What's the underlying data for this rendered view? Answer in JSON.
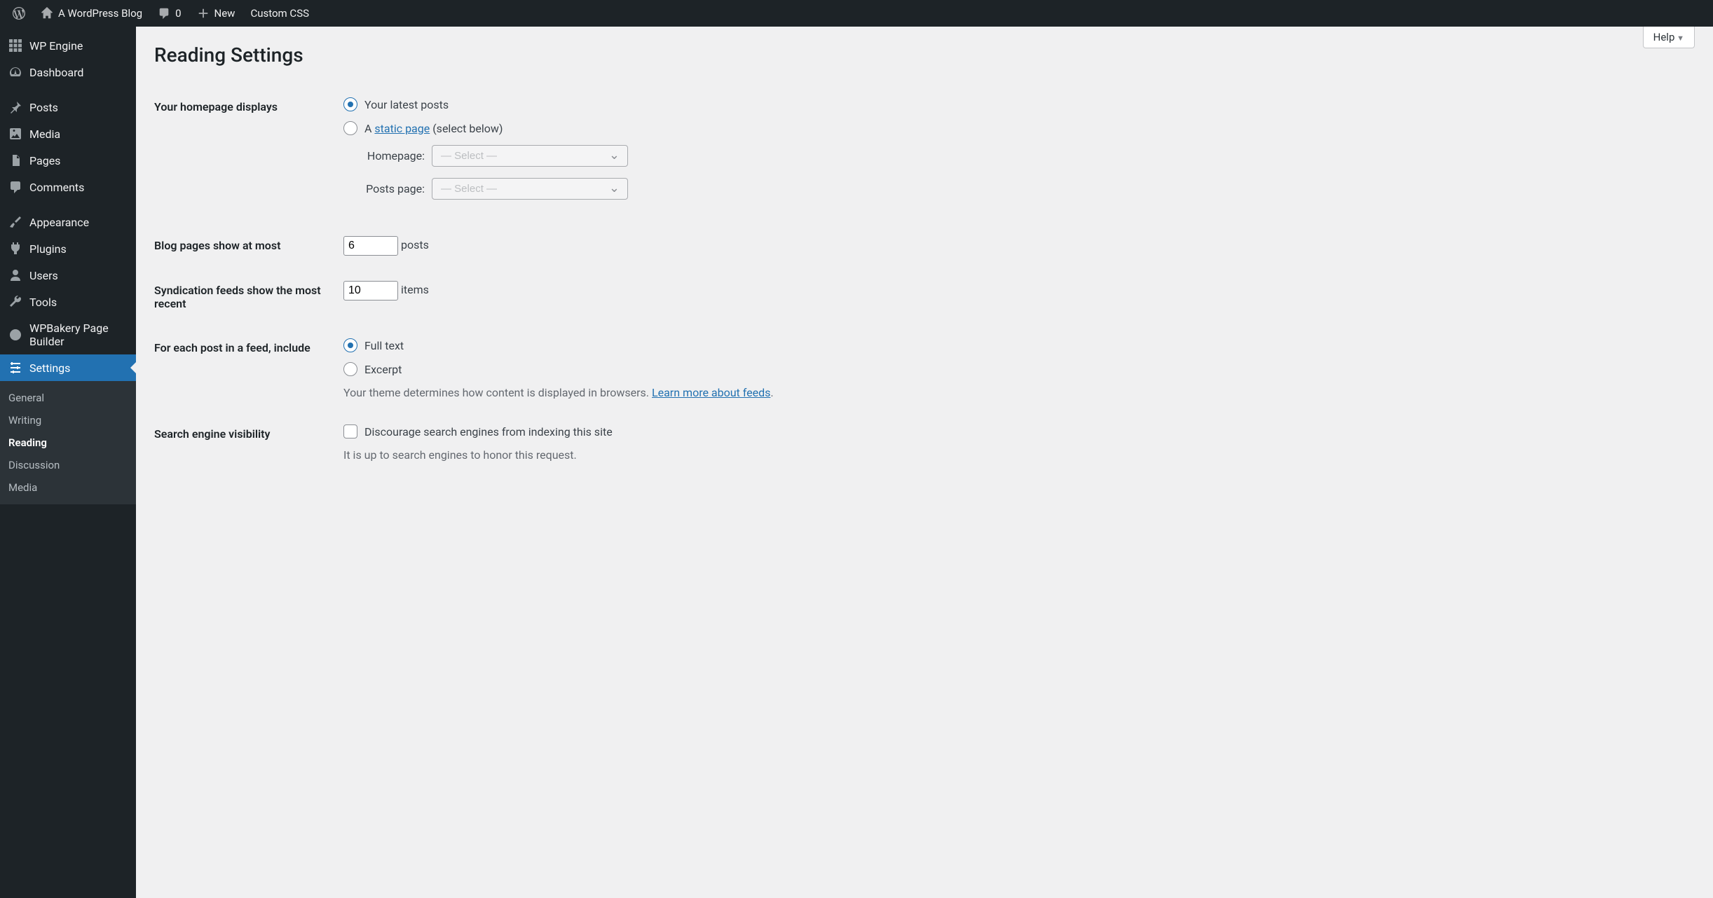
{
  "adminbar": {
    "site_name": "A WordPress Blog",
    "comments_count": "0",
    "new_label": "New",
    "custom_css": "Custom CSS"
  },
  "sidebar": {
    "items": [
      {
        "label": "WP Engine"
      },
      {
        "label": "Dashboard"
      },
      {
        "label": "Posts"
      },
      {
        "label": "Media"
      },
      {
        "label": "Pages"
      },
      {
        "label": "Comments"
      },
      {
        "label": "Appearance"
      },
      {
        "label": "Plugins"
      },
      {
        "label": "Users"
      },
      {
        "label": "Tools"
      },
      {
        "label": "WPBakery Page Builder"
      },
      {
        "label": "Settings"
      }
    ],
    "settings_submenu": [
      {
        "label": "General"
      },
      {
        "label": "Writing"
      },
      {
        "label": "Reading"
      },
      {
        "label": "Discussion"
      },
      {
        "label": "Media"
      }
    ]
  },
  "help_label": "Help",
  "page_title": "Reading Settings",
  "form": {
    "homepage_displays_label": "Your homepage displays",
    "option_latest_posts": "Your latest posts",
    "option_static_prefix": "A ",
    "option_static_link": "static page",
    "option_static_suffix": " (select below)",
    "homepage_select_label": "Homepage:",
    "posts_page_select_label": "Posts page:",
    "select_placeholder": "— Select —",
    "blog_pages_label": "Blog pages show at most",
    "blog_pages_value": "6",
    "blog_pages_unit": "posts",
    "syndication_label": "Syndication feeds show the most recent",
    "syndication_value": "10",
    "syndication_unit": "items",
    "feed_include_label": "For each post in a feed, include",
    "feed_full_text": "Full text",
    "feed_excerpt": "Excerpt",
    "feed_desc_prefix": "Your theme determines how content is displayed in browsers. ",
    "feed_desc_link": "Learn more about feeds",
    "feed_desc_suffix": ".",
    "sev_label": "Search engine visibility",
    "sev_checkbox": "Discourage search engines from indexing this site",
    "sev_desc": "It is up to search engines to honor this request."
  }
}
